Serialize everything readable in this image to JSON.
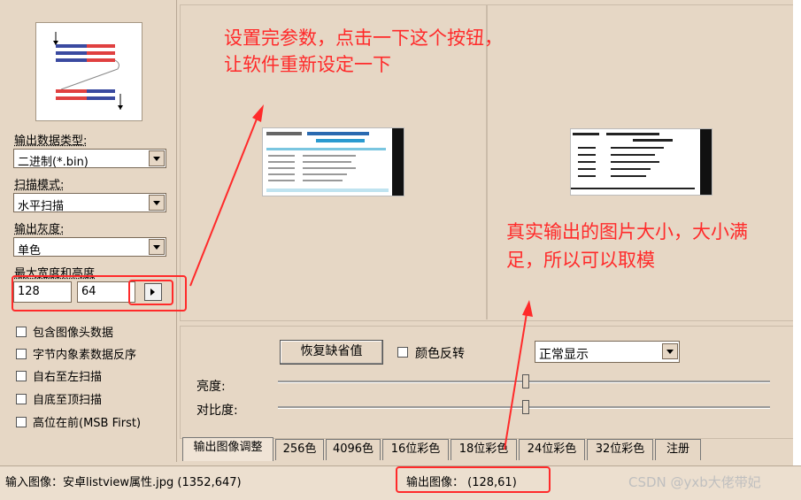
{
  "left": {
    "output_type_label": "输出数据类型:",
    "output_type_value": "二进制(*.bin)",
    "scan_mode_label": "扫描模式:",
    "scan_mode_value": "水平扫描",
    "gray_label": "输出灰度:",
    "gray_value": "单色",
    "size_label": "最大宽度和高度",
    "width_value": "128",
    "height_value": "64",
    "checkboxes": [
      "包含图像头数据",
      "字节内象素数据反序",
      "自右至左扫描",
      "自底至顶扫描",
      "高位在前(MSB First)"
    ]
  },
  "controls": {
    "restore_button": "恢复缺省值",
    "invert_label": "颜色反转",
    "display_mode": "正常显示",
    "brightness_label": "亮度:",
    "contrast_label": "对比度:"
  },
  "tabs": [
    "输出图像调整",
    "256色",
    "4096色",
    "16位彩色",
    "18位彩色",
    "24位彩色",
    "32位彩色",
    "注册"
  ],
  "status": {
    "input_image": "输入图像：安卓listview属性.jpg (1352,647)",
    "output_image": "输出图像：   (128,61)",
    "watermark": "CSDN @yxb大佬带妃"
  },
  "annotations": {
    "top_note_line1": "设置完参数，点击一下这个按钮，",
    "top_note_line2": "让软件重新设定一下",
    "right_note_line1": "真实输出的图片大小，大小满",
    "right_note_line2": "足，所以可以取模"
  },
  "colors": {
    "background": "#e6d7c5",
    "annotation": "#ff2a2a"
  }
}
